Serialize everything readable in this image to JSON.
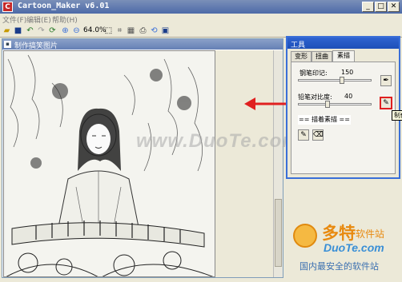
{
  "window": {
    "title": "Cartoon_Maker v6.01",
    "icon": "app-icon"
  },
  "menu": [
    {
      "label": "文件(F)"
    },
    {
      "label": "编辑(E)"
    },
    {
      "label": "帮助(H)"
    }
  ],
  "toolbar": {
    "zoom": "64.0%"
  },
  "child_window": {
    "title": "制作搞笑图片"
  },
  "tool_window": {
    "title": "工具",
    "tabs": [
      "变形",
      "扭曲",
      "素描"
    ],
    "active_tab": "素描",
    "pen_mark": {
      "label": "钢笔印记:",
      "value": "150",
      "level": 0.6
    },
    "pencil_contrast": {
      "label": "铅笔对比度:",
      "value": "40",
      "level": 0.4
    },
    "sketch_mode": "== 描着素描 =="
  },
  "tooltip": {
    "text": "制作铅笔"
  },
  "watermark": {
    "text": "www.DuoTe.com"
  },
  "logo": {
    "main": "多特",
    "sub": "软件站",
    "url": "DuoTe.com",
    "slogan": "国内最安全的软件站"
  },
  "colors": {
    "accent": "#3a6fd8",
    "arrow": "#e02020",
    "hint_border": "#e02020"
  }
}
